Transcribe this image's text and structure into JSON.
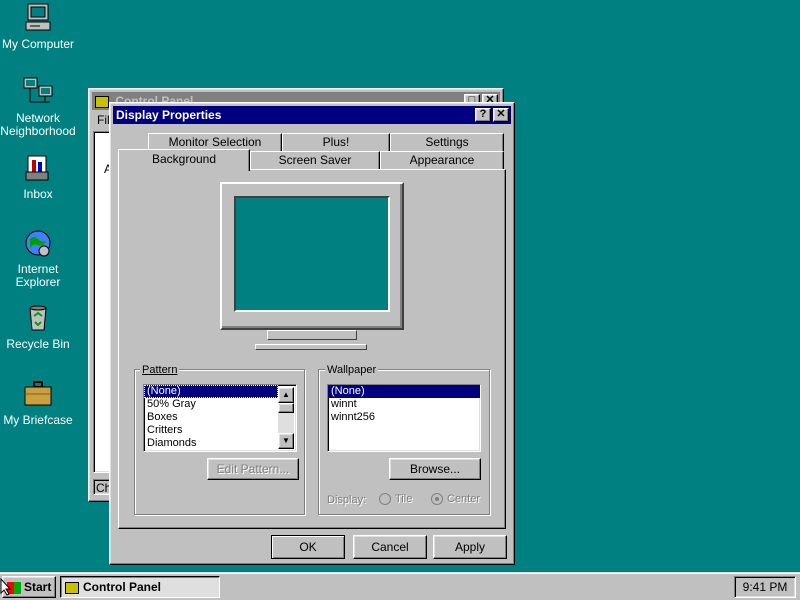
{
  "desktop": {
    "icons": [
      {
        "label": "My Computer",
        "icon": "my-computer-icon"
      },
      {
        "label": "Network Neighborhood",
        "label_line1": "Network",
        "label_line2": "Neighborhood",
        "icon": "network-neighborhood-icon"
      },
      {
        "label": "Inbox",
        "icon": "inbox-icon"
      },
      {
        "label": "Internet Explorer",
        "label_line1": "Internet",
        "label_line2": "Explorer",
        "icon": "internet-explorer-icon"
      },
      {
        "label": "Recycle Bin",
        "icon": "recycle-bin-icon"
      },
      {
        "label": "My Briefcase",
        "icon": "briefcase-icon"
      }
    ]
  },
  "control_panel": {
    "title": "Control Panel",
    "menu_first": "File",
    "content_first_letter": "A",
    "status_text": "Che"
  },
  "dialog": {
    "title": "Display Properties",
    "tabs_back": [
      "Monitor Selection",
      "Plus!",
      "Settings"
    ],
    "tabs_front": [
      "Background",
      "Screen Saver",
      "Appearance"
    ],
    "active_tab": "Background",
    "pattern": {
      "label": "Pattern",
      "items": [
        "(None)",
        "50% Gray",
        "Boxes",
        "Critters",
        "Diamonds"
      ],
      "selected": "(None)",
      "edit_button": "Edit Pattern..."
    },
    "wallpaper": {
      "label": "Wallpaper",
      "items": [
        "(None)",
        "winnt",
        "winnt256"
      ],
      "selected": "(None)",
      "browse_button": "Browse...",
      "display_label": "Display:",
      "tile_label": "Tile",
      "center_label": "Center",
      "display_selected": "Center"
    },
    "buttons": {
      "ok": "OK",
      "cancel": "Cancel",
      "apply": "Apply"
    }
  },
  "taskbar": {
    "start_label": "Start",
    "task_label": "Control Panel",
    "clock": "9:41 PM"
  },
  "colors": {
    "desktop": "#008080",
    "titlebar_active": "#000080",
    "titlebar_inactive": "#808080",
    "face": "#c0c0c0",
    "selection": "#000080"
  }
}
